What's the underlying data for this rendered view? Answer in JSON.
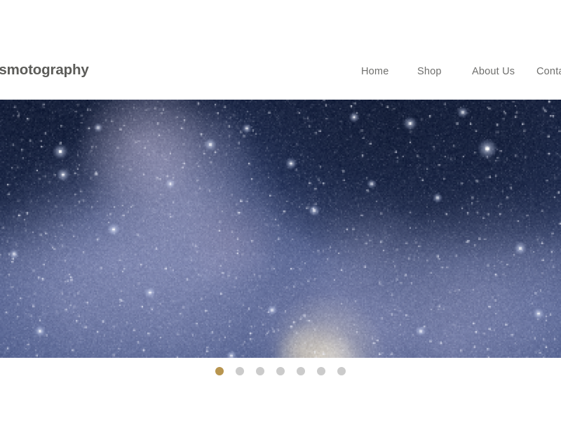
{
  "site": {
    "brand_label": "Cosmotography",
    "brand_visible_text": "osmotography"
  },
  "header": {
    "nav": [
      {
        "label": "Home",
        "active": true
      },
      {
        "label": "Shop",
        "active": false
      },
      {
        "label": "About Us",
        "active": false
      },
      {
        "label": "Conta",
        "full_label": "Contact",
        "active": false
      }
    ],
    "nav_text_color": "#6f6f6d",
    "brand_text_color": "#5c5c59",
    "background": "#ffffff"
  },
  "hero": {
    "alt": "Milky Way galaxy starfield photograph",
    "image_name": "milky-way-starfield",
    "palette": {
      "deep_navy": "#16203a",
      "mid_blue": "#3e5081",
      "nebula_lavender": "#9fa3c8",
      "pale_violet": "#b9b4d2",
      "core_cream": "#ddd4c0",
      "star_white": "#ffffff"
    }
  },
  "carousel": {
    "total_slides": 7,
    "active_index": 0,
    "active_color": "#b8954f",
    "inactive_color": "#cbcbcb",
    "dots": [
      {
        "index": 1,
        "active": true
      },
      {
        "index": 2,
        "active": false
      },
      {
        "index": 3,
        "active": false
      },
      {
        "index": 4,
        "active": false
      },
      {
        "index": 5,
        "active": false
      },
      {
        "index": 6,
        "active": false
      },
      {
        "index": 7,
        "active": false
      }
    ]
  }
}
